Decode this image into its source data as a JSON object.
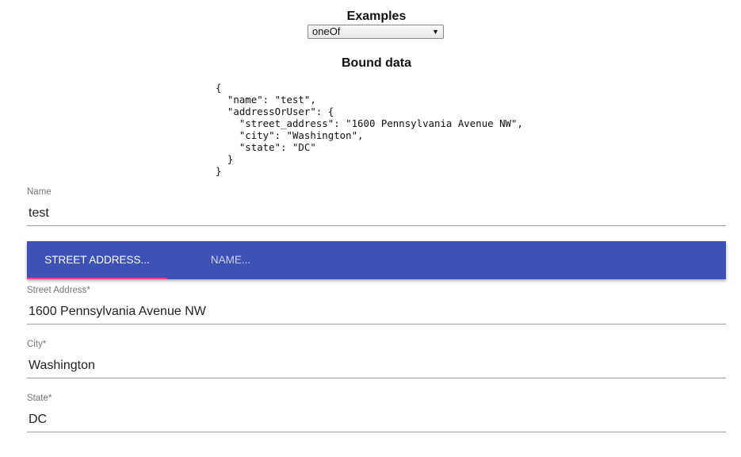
{
  "examples": {
    "title": "Examples",
    "selected": "oneOf"
  },
  "bound": {
    "title": "Bound data",
    "json": "{\n  \"name\": \"test\",\n  \"addressOrUser\": {\n    \"street_address\": \"1600 Pennsylvania Avenue NW\",\n    \"city\": \"Washington\",\n    \"state\": \"DC\"\n  }\n}"
  },
  "form": {
    "name": {
      "label": "Name",
      "value": "test"
    },
    "tabs": [
      {
        "label": "Street Address..."
      },
      {
        "label": "Name..."
      }
    ],
    "street_address": {
      "label": "Street Address*",
      "value": "1600 Pennsylvania Avenue NW"
    },
    "city": {
      "label": "City*",
      "value": "Washington"
    },
    "state": {
      "label": "State*",
      "value": "DC"
    }
  },
  "colors": {
    "tabbar": "#3f51b5",
    "indicator": "#ff4081"
  }
}
